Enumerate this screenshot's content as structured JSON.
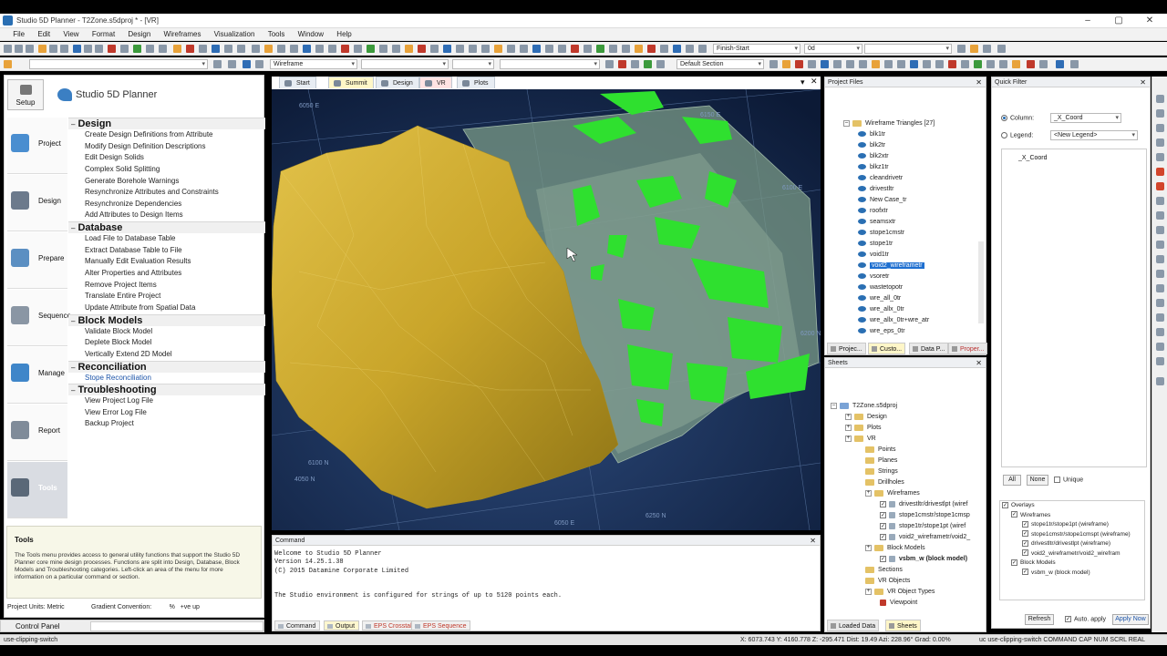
{
  "window": {
    "title": "Studio 5D Planner - T2Zone.s5dproj * - [VR]"
  },
  "menu": [
    "File",
    "Edit",
    "View",
    "Format",
    "Design",
    "Wireframes",
    "Visualization",
    "Tools",
    "Window",
    "Help"
  ],
  "toolbar": {
    "sort_combo": "Finish-Start",
    "zero_combo": "0d",
    "wire_combo": "Wireframe",
    "section_combo": "Default Section"
  },
  "left": {
    "setup_label": "Setup",
    "app_name": "Studio 5D Planner",
    "nav": [
      "Project",
      "Design",
      "Prepare",
      "Sequence",
      "Manage",
      "Report",
      "Tools"
    ],
    "sections": [
      {
        "title": "Design",
        "items": [
          "Create Design Definitions from Attribute",
          "Modify Design Definition Descriptions",
          "Edit Design Solids",
          "Complex Solid Splitting",
          "Generate Borehole Warnings",
          "Resynchronize Attributes and Constraints",
          "Resynchronize Dependencies",
          "Add Attributes to Design Items"
        ]
      },
      {
        "title": "Database",
        "items": [
          "Load File to Database Table",
          "Extract Database Table to File",
          "Manually Edit Evaluation Results",
          "Alter Properties and Attributes",
          "Remove Project Items",
          "Translate Entire Project",
          "Update Attribute from Spatial Data"
        ]
      },
      {
        "title": "Block Models",
        "items": [
          "Validate Block Model",
          "Deplete Block Model",
          "Vertically Extend 2D Model"
        ]
      },
      {
        "title": "Reconciliation",
        "items": [
          "Stope Reconciliation"
        ]
      },
      {
        "title": "Troubleshooting",
        "items": [
          "View Project Log File",
          "View Error Log File",
          "Backup Project"
        ]
      }
    ],
    "help_title": "Tools",
    "help_text": "The Tools menu provides access to general utility functions that support the Studio 5D Planner core mine design processes. Functions are split into Design, Database, Block Models and Troubleshooting categories. Left-click an area of the menu for more information on a particular command or section.",
    "units": "Project Units: Metric",
    "gradient": "Gradient Convention:",
    "gradient_value": "%",
    "gradient_sign": "+ve up",
    "control_panel": "Control Panel"
  },
  "viewport": {
    "tabs": [
      "Start",
      "Summit",
      "Design",
      "VR",
      "Plots"
    ],
    "grid_labels": [
      "6050 E",
      "6100 E",
      "6150 E",
      "6200 N",
      "6250 N",
      "4050 N",
      "6100 N",
      "6050 E"
    ]
  },
  "command": {
    "title": "Command",
    "lines": [
      "Welcome to Studio 5D Planner",
      "Version 14.25.1.38",
      "(C) 2015 Datamine Corporate Limited",
      "",
      "",
      "The Studio environment is configured for strings of up to 5120 points each."
    ],
    "tabs": [
      "Command",
      "Output",
      "EPS Crosstab",
      "EPS Sequence"
    ]
  },
  "project_files": {
    "title": "Project Files",
    "group": "Wireframe Triangles [27]",
    "items": [
      "blk1tr",
      "blk2tr",
      "blk2xtr",
      "blkz1tr",
      "cleandrivetr",
      "drivestltr",
      "New Case_tr",
      "roofxtr",
      "seamsxtr",
      "stope1cmstr",
      "stope1tr",
      "void1tr",
      "void2_wireframetr",
      "vsoretr",
      "wastetopotr",
      "wre_all_0tr",
      "wre_allx_0tr",
      "wre_allx_0tr+wre_atr",
      "wre_eps_0tr"
    ],
    "selected": "void2_wireframetr",
    "tabs": [
      "Projec...",
      "Custo...",
      "Data P...",
      "Proper..."
    ]
  },
  "sheets": {
    "title": "Sheets",
    "root": "T2Zone.s5dproj",
    "nodes": [
      "Design",
      "Plots",
      "VR",
      "Points",
      "Planes",
      "Strings",
      "Drillholes",
      "Wireframes",
      "drivestltr/drivestlpt (wiref",
      "stope1cmstr/stope1cmsp",
      "stope1tr/stope1pt (wiref",
      "void2_wireframetr/void2_",
      "Block Models",
      "vsbm_w (block model)",
      "Sections",
      "VR Objects",
      "VR Object Types",
      "Viewpoint"
    ],
    "tabs": [
      "Loaded Data",
      "Sheets"
    ]
  },
  "quick_filter": {
    "title": "Quick Filter",
    "column_label": "Column:",
    "column_value": "_X_Coord",
    "legend_label": "Legend:",
    "legend_value": "<New Legend>",
    "list_item": "_X_Coord",
    "btn_all": "All",
    "btn_none": "None",
    "unique": "Unique",
    "overlays": [
      "Overlays",
      "Wireframes",
      "stope1tr/stope1pt (wireframe)",
      "stope1cmstr/stope1cmspt (wireframe)",
      "drivestltr/drivestlpt (wireframe)",
      "void2_wireframetr/void2_wirefram",
      "Block Models",
      "vsbm_w (block model)"
    ],
    "refresh": "Refresh",
    "auto_apply": "Auto. apply",
    "apply_now": "Apply Now"
  },
  "status": {
    "left": "use-clipping-switch",
    "coords": "X: 6073.743  Y: 4160.778  Z: -295.471  Dist: 19.49  Azi: 228.96°  Grad: 0.00%",
    "right": "uc use-clipping-switch  COMMAND  CAP  NUM  SCRL  REAL"
  }
}
